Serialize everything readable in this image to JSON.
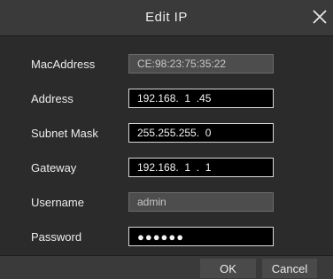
{
  "dialog": {
    "title": "Edit IP",
    "close_icon": "close-icon"
  },
  "form": {
    "mac": {
      "label": "MacAddress",
      "value": "CE:98:23:75:35:22"
    },
    "address": {
      "label": "Address",
      "value": "192.168.  1  .45"
    },
    "subnet": {
      "label": "Subnet Mask",
      "value": "255.255.255.  0"
    },
    "gateway": {
      "label": "Gateway",
      "value": "192.168.  1  .  1"
    },
    "username": {
      "label": "Username",
      "value": "admin"
    },
    "password": {
      "label": "Password",
      "value": "●●●●●●"
    }
  },
  "footer": {
    "ok_label": "OK",
    "cancel_label": "Cancel"
  }
}
